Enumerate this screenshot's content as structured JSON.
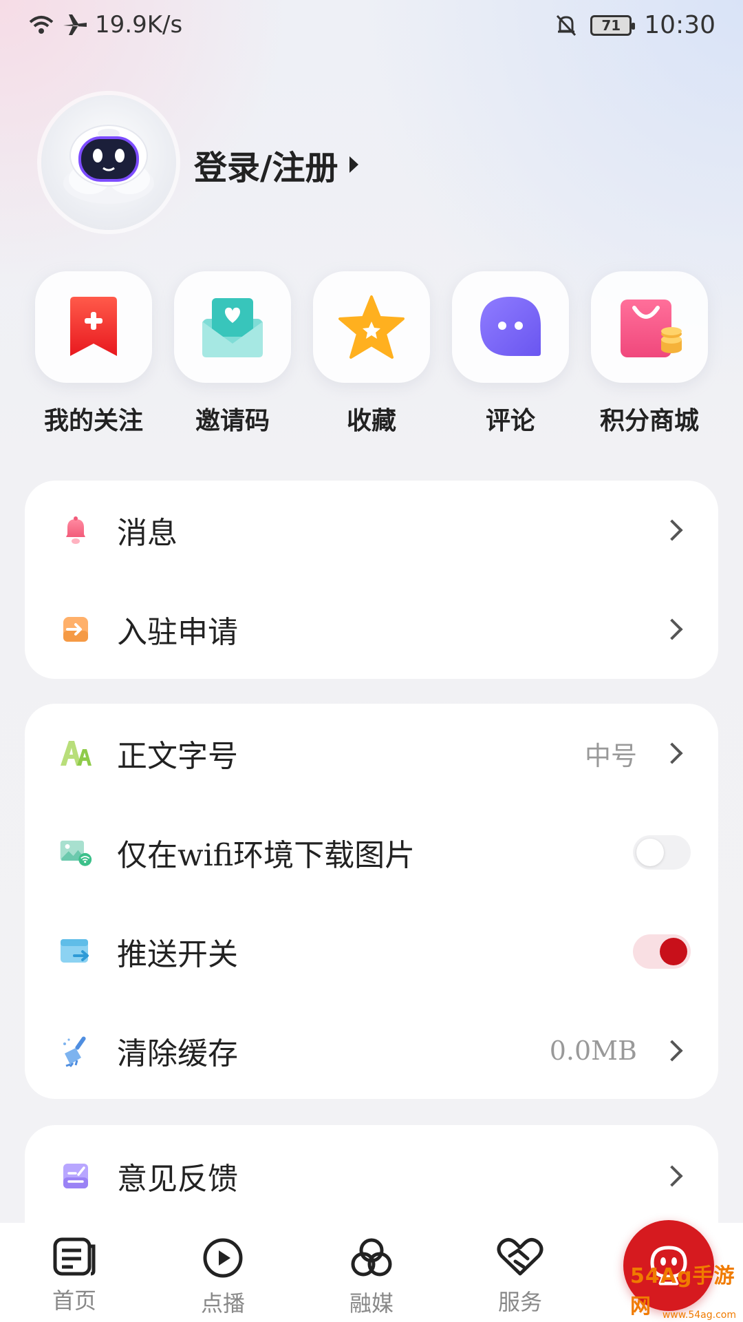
{
  "status_bar": {
    "network_speed": "19.9K/s",
    "battery_level": "71",
    "time": "10:30"
  },
  "profile": {
    "login_text": "登录/注册"
  },
  "shortcuts": [
    {
      "label": "我的关注",
      "icon": "red-bookmark-plus-icon"
    },
    {
      "label": "邀请码",
      "icon": "teal-envelope-heart-icon"
    },
    {
      "label": "收藏",
      "icon": "yellow-star-icon"
    },
    {
      "label": "评论",
      "icon": "purple-chat-bubble-icon"
    },
    {
      "label": "积分商城",
      "icon": "pink-shopping-bag-icon"
    }
  ],
  "card1": [
    {
      "label": "消息",
      "icon": "bell-icon"
    },
    {
      "label": "入驻申请",
      "icon": "enter-icon"
    }
  ],
  "card2": {
    "font_size": {
      "label": "正文字号",
      "value": "中号"
    },
    "wifi_images": {
      "label": "仅在wifi环境下载图片",
      "enabled": false
    },
    "push": {
      "label": "推送开关",
      "enabled": true
    },
    "cache": {
      "label": "清除缓存",
      "value": "0.0MB"
    }
  },
  "card3": {
    "feedback": {
      "label": "意见反馈"
    }
  },
  "tabbar": [
    {
      "label": "首页",
      "icon": "home-article-icon"
    },
    {
      "label": "点播",
      "icon": "play-icon"
    },
    {
      "label": "融媒",
      "icon": "media-circles-icon"
    },
    {
      "label": "服务",
      "icon": "heart-handshake-icon"
    }
  ],
  "center_button": {
    "icon": "robot-face-icon"
  },
  "watermark": {
    "text": "54Ag手游网",
    "sub": "www.54ag.com"
  },
  "colors": {
    "accent": "#d61a1f",
    "toggle_on": "#c8101a"
  }
}
